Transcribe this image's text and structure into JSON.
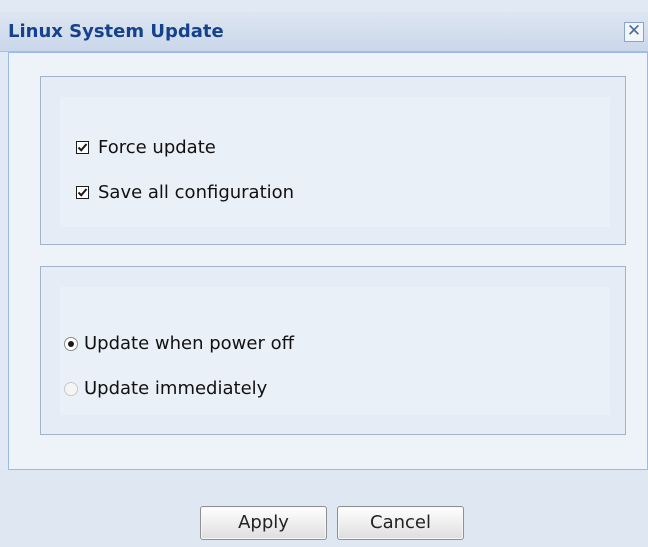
{
  "dialog": {
    "title": "Linux System Update",
    "close_glyph": "✕"
  },
  "options": {
    "force_update": {
      "label": "Force update",
      "checked": true
    },
    "save_config": {
      "label": "Save all configuration",
      "checked": true
    }
  },
  "update_mode": {
    "power_off": {
      "label": "Update when power off",
      "selected": true
    },
    "immediately": {
      "label": "Update immediately",
      "selected": false
    }
  },
  "footer": {
    "apply_label": "Apply",
    "cancel_label": "Cancel"
  },
  "colors": {
    "title_text": "#15428b",
    "panel_bg": "#e1e9f4",
    "border": "#99bbe8"
  }
}
